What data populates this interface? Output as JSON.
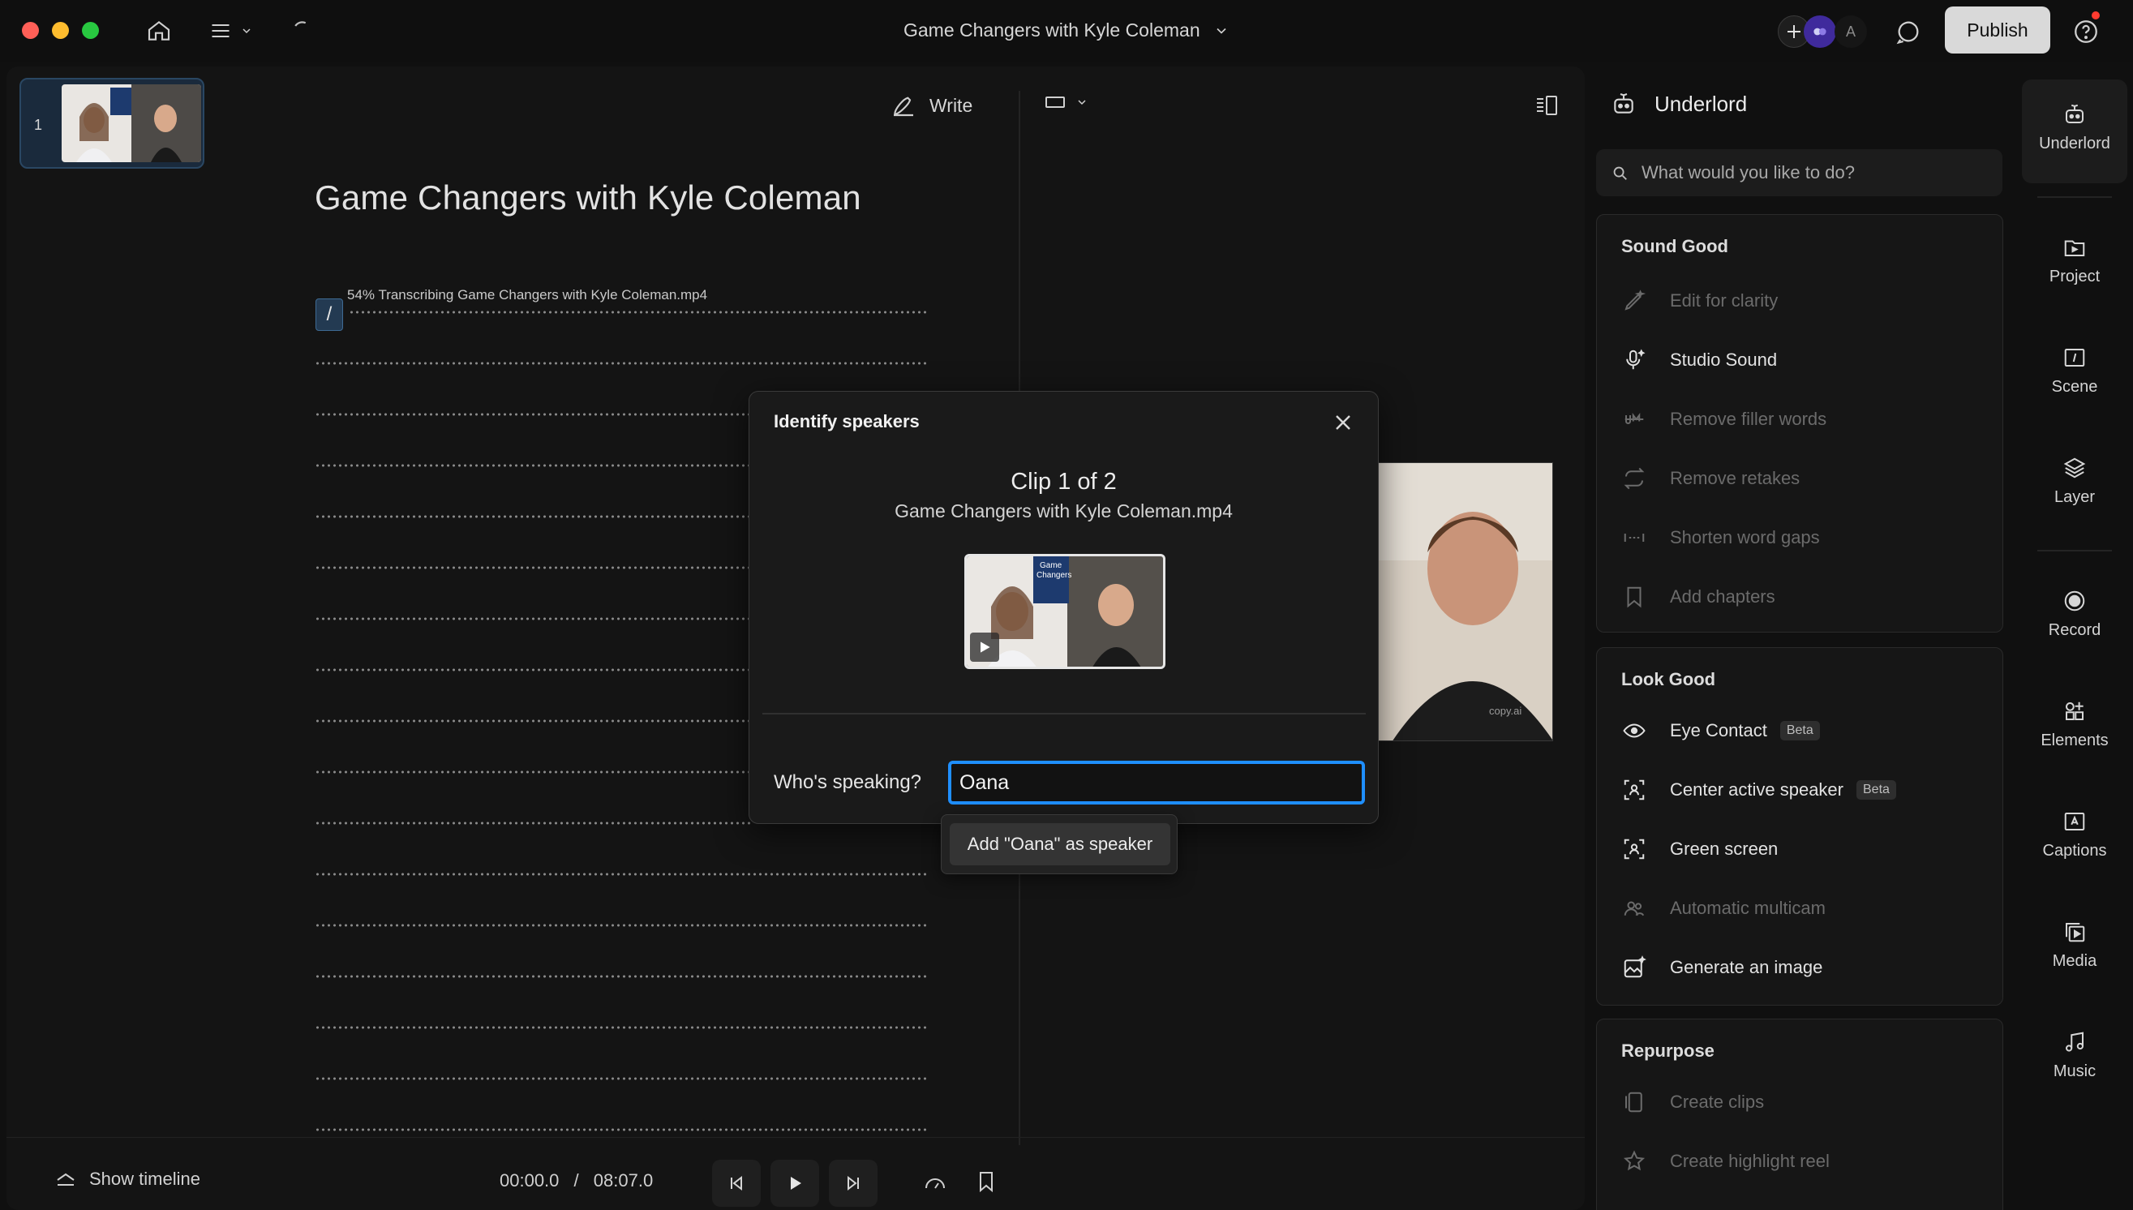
{
  "window": {
    "title": "Game Changers with Kyle Coleman",
    "publish_label": "Publish",
    "avatar_letter": "A"
  },
  "editor": {
    "scene_number": "1",
    "write_label": "Write",
    "title": "Game Changers with Kyle Coleman",
    "cursor_char": "/",
    "transcribing_status": "54% Transcribing Game Changers with Kyle Coleman.mp4"
  },
  "transport": {
    "show_timeline_label": "Show timeline",
    "current_time": "00:00.0",
    "separator": "/",
    "total_time": "08:07.0"
  },
  "dialog": {
    "title": "Identify speakers",
    "clip_label": "Clip 1 of 2",
    "clip_file": "Game Changers with Kyle Coleman.mp4",
    "question": "Who's speaking?",
    "speaker_value": "Oana",
    "suggestion": "Add \"Oana\" as speaker"
  },
  "underlord": {
    "title": "Underlord",
    "search_placeholder": "What would you like to do?",
    "sections": [
      {
        "title": "Sound Good",
        "items": [
          {
            "label": "Edit for clarity",
            "enabled": false,
            "icon": "pen-sparkle-icon"
          },
          {
            "label": "Studio Sound",
            "enabled": true,
            "icon": "mic-sparkle-icon"
          },
          {
            "label": "Remove filler words",
            "enabled": false,
            "icon": "strikethrough-um-icon"
          },
          {
            "label": "Remove retakes",
            "enabled": false,
            "icon": "repeat-icon"
          },
          {
            "label": "Shorten word gaps",
            "enabled": false,
            "icon": "gap-icon"
          },
          {
            "label": "Add chapters",
            "enabled": false,
            "icon": "bookmark-icon"
          }
        ]
      },
      {
        "title": "Look Good",
        "items": [
          {
            "label": "Eye Contact",
            "enabled": true,
            "icon": "eye-icon",
            "badge": "Beta"
          },
          {
            "label": "Center active speaker",
            "enabled": true,
            "icon": "speaker-frame-icon",
            "badge": "Beta"
          },
          {
            "label": "Green screen",
            "enabled": true,
            "icon": "green-screen-icon"
          },
          {
            "label": "Automatic multicam",
            "enabled": false,
            "icon": "people-icon"
          },
          {
            "label": "Generate an image",
            "enabled": true,
            "icon": "image-sparkle-icon"
          }
        ]
      },
      {
        "title": "Repurpose",
        "items": [
          {
            "label": "Create clips",
            "enabled": false,
            "icon": "clips-icon"
          },
          {
            "label": "Create highlight reel",
            "enabled": false,
            "icon": "star-icon"
          }
        ]
      }
    ]
  },
  "rail": [
    {
      "label": "Underlord",
      "icon": "robot-icon",
      "active": true
    },
    {
      "label": "Project",
      "icon": "project-icon"
    },
    {
      "label": "Scene",
      "icon": "scene-icon"
    },
    {
      "label": "Layer",
      "icon": "layers-icon"
    },
    {
      "label": "Record",
      "icon": "record-icon"
    },
    {
      "label": "Elements",
      "icon": "elements-icon"
    },
    {
      "label": "Captions",
      "icon": "captions-icon"
    },
    {
      "label": "Media",
      "icon": "media-icon"
    },
    {
      "label": "Music",
      "icon": "music-icon"
    }
  ],
  "colors": {
    "accent": "#1f8fff",
    "publish_bg": "#d9d9d9",
    "background": "#101010",
    "panel": "#141414",
    "notification": "#ff3b30"
  }
}
